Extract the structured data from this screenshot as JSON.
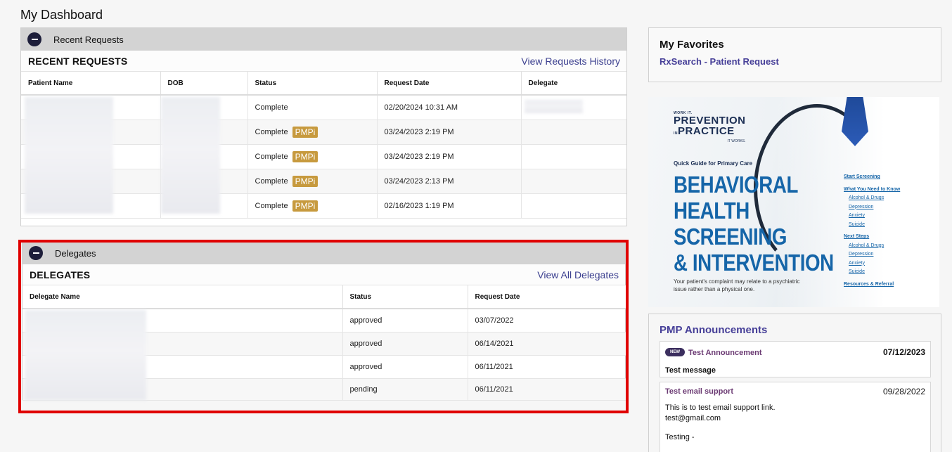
{
  "page_title": "My Dashboard",
  "recent_requests": {
    "header_label": "Recent Requests",
    "title": "RECENT REQUESTS",
    "history_link": "View Requests History",
    "columns": [
      "Patient Name",
      "DOB",
      "Status",
      "Request Date",
      "Delegate"
    ],
    "rows": [
      {
        "status": "Complete",
        "badge": "",
        "date": "02/20/2024 10:31 AM"
      },
      {
        "status": "Complete",
        "badge": "PMPi",
        "date": "03/24/2023 2:19 PM"
      },
      {
        "status": "Complete",
        "badge": "PMPi",
        "date": "03/24/2023 2:19 PM"
      },
      {
        "status": "Complete",
        "badge": "PMPi",
        "date": "03/24/2023 2:13 PM"
      },
      {
        "status": "Complete",
        "badge": "PMPi",
        "date": "02/16/2023 1:19 PM"
      }
    ]
  },
  "delegates": {
    "header_label": "Delegates",
    "title": "DELEGATES",
    "view_all_link": "View All Delegates",
    "columns": [
      "Delegate Name",
      "Status",
      "Request Date"
    ],
    "rows": [
      {
        "status": "approved",
        "date": "03/07/2022"
      },
      {
        "status": "approved",
        "date": "06/14/2021"
      },
      {
        "status": "approved",
        "date": "06/11/2021"
      },
      {
        "status": "pending",
        "date": "06/11/2021"
      }
    ]
  },
  "favorites": {
    "title": "My Favorites",
    "link": "RxSearch - Patient Request"
  },
  "banner": {
    "brand_top": "WORK IT.",
    "brand_line1": "PREVENTION",
    "brand_in": "IN",
    "brand_line2": "PRACTICE",
    "brand_bottom": "IT WORKS.",
    "guide": "Quick Guide for Primary Care",
    "headline1": "BEHAVIORAL",
    "headline2": "HEALTH",
    "headline3": "SCREENING",
    "headline4": "& INTERVENTION",
    "subtext": "Your patient's complaint may relate to a psychiatric issue rather than a physical one.",
    "link_start": "Start Screening",
    "link_need": "What You Need to Know",
    "need_items": [
      "Alcohol & Drugs",
      "Depression",
      "Anxiety",
      "Suicide"
    ],
    "link_next": "Next Steps",
    "next_items": [
      "Alcohol & Drugs",
      "Depression",
      "Anxiety",
      "Suicide"
    ],
    "link_resources": "Resources & Referral"
  },
  "announcements": {
    "title": "PMP Announcements",
    "items": [
      {
        "badge": "NEW",
        "name": "Test Announcement",
        "date": "07/12/2023",
        "message": "Test message"
      },
      {
        "name": "Test email support",
        "date": "09/28/2022",
        "line1": "This is to test email support link.",
        "line2": "test@gmail.com",
        "line3": "Testing -"
      }
    ]
  },
  "colors": {
    "header_gray": "#d3d3d3",
    "link_purple": "#463f98",
    "badge_gold": "#c79a3e",
    "highlight_red": "#e00000"
  }
}
